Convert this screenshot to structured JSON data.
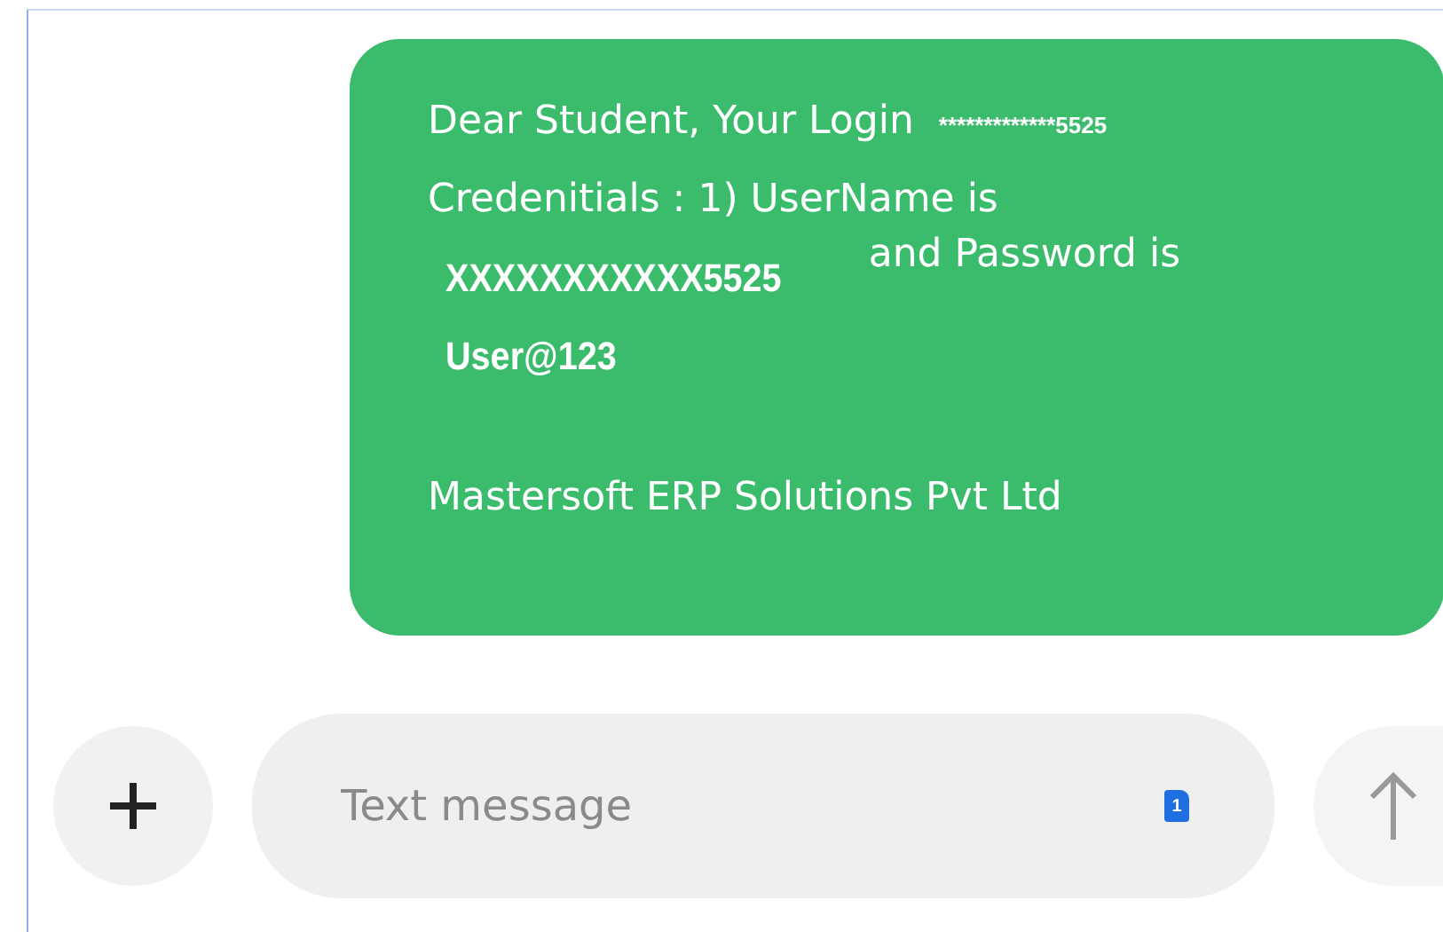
{
  "message": {
    "lines": [
      {
        "kind": "row",
        "parts": [
          {
            "kind": "handwriting",
            "text": "Dear Student, Your Login"
          },
          {
            "kind": "tiny",
            "text": "*************5525"
          }
        ]
      },
      {
        "kind": "row",
        "parts": [
          {
            "kind": "handwriting",
            "text": "Credenitials : 1) UserName is"
          }
        ]
      },
      {
        "kind": "row",
        "parts": [
          {
            "kind": "bold",
            "text": "XXXXXXXXXXX5525"
          },
          {
            "kind": "raised",
            "text": "and Password is"
          }
        ]
      },
      {
        "kind": "row",
        "parts": [
          {
            "kind": "bold",
            "text": "User@123"
          }
        ]
      },
      {
        "kind": "gap"
      },
      {
        "kind": "row",
        "parts": [
          {
            "kind": "handwriting",
            "text": "Mastersoft ERP Solutions Pvt Ltd"
          }
        ]
      }
    ]
  },
  "composer": {
    "placeholder": "Text message",
    "sim_badge": "1"
  }
}
